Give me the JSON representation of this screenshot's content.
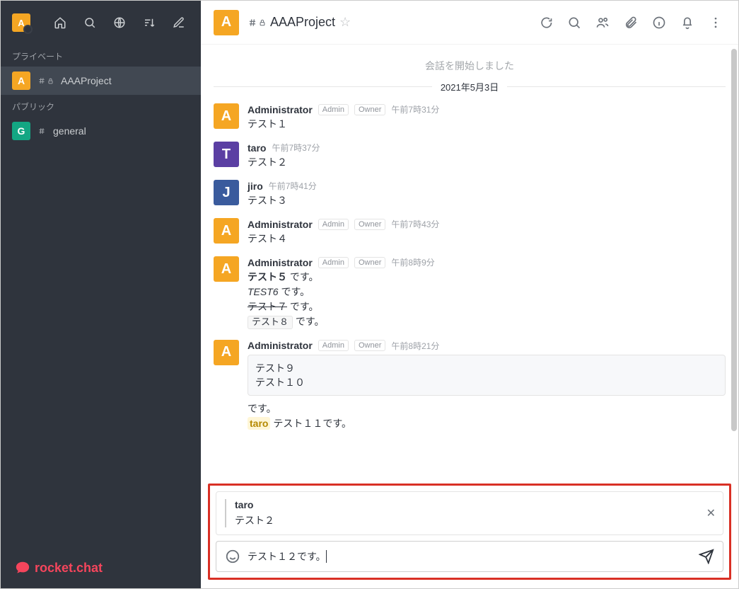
{
  "sidebar": {
    "user_initial": "A",
    "sections": {
      "private_label": "プライベート",
      "public_label": "パブリック"
    },
    "channels": [
      {
        "avatar_letter": "A",
        "avatar_class": "orange",
        "name": "AAAProject",
        "private": true,
        "active": true
      },
      {
        "avatar_letter": "G",
        "avatar_class": "teal",
        "name": "general",
        "private": false,
        "active": false
      }
    ],
    "brand": "rocket.chat"
  },
  "room": {
    "avatar_letter": "A",
    "name": "AAAProject",
    "start_text": "会話を開始しました",
    "date": "2021年5月3日"
  },
  "messages": [
    {
      "avatar": "A",
      "avatar_class": "orange",
      "name": "Administrator",
      "roles": [
        "Admin",
        "Owner"
      ],
      "time": "午前7時31分",
      "body": [
        {
          "type": "text",
          "value": "テスト１"
        }
      ]
    },
    {
      "avatar": "T",
      "avatar_class": "purple",
      "name": "taro",
      "roles": [],
      "time": "午前7時37分",
      "body": [
        {
          "type": "text",
          "value": "テスト２"
        }
      ]
    },
    {
      "avatar": "J",
      "avatar_class": "blue",
      "name": "jiro",
      "roles": [],
      "time": "午前7時41分",
      "body": [
        {
          "type": "text",
          "value": "テスト３"
        }
      ]
    },
    {
      "avatar": "A",
      "avatar_class": "orange",
      "name": "Administrator",
      "roles": [
        "Admin",
        "Owner"
      ],
      "time": "午前7時43分",
      "body": [
        {
          "type": "text",
          "value": "テスト４"
        }
      ]
    },
    {
      "avatar": "A",
      "avatar_class": "orange",
      "name": "Administrator",
      "roles": [
        "Admin",
        "Owner"
      ],
      "time": "午前8時9分",
      "body": [
        {
          "type": "bold",
          "value": "テスト５",
          "suffix": " です。"
        },
        {
          "type": "italic",
          "value": "TEST6",
          "suffix": " です。"
        },
        {
          "type": "strike",
          "value": "テスト７",
          "suffix": " です。"
        },
        {
          "type": "code",
          "value": "テスト８",
          "suffix": " です。"
        }
      ]
    },
    {
      "avatar": "A",
      "avatar_class": "orange",
      "name": "Administrator",
      "roles": [
        "Admin",
        "Owner"
      ],
      "time": "午前8時21分",
      "body": [
        {
          "type": "codeblock",
          "value": "テスト９\nテスト１０"
        },
        {
          "type": "text",
          "value": "です。"
        },
        {
          "type": "mention",
          "value": "taro",
          "suffix": " テスト１１です。"
        }
      ]
    }
  ],
  "composer": {
    "quote_name": "taro",
    "quote_text": "テスト２",
    "input_value": "テスト１２です。"
  }
}
